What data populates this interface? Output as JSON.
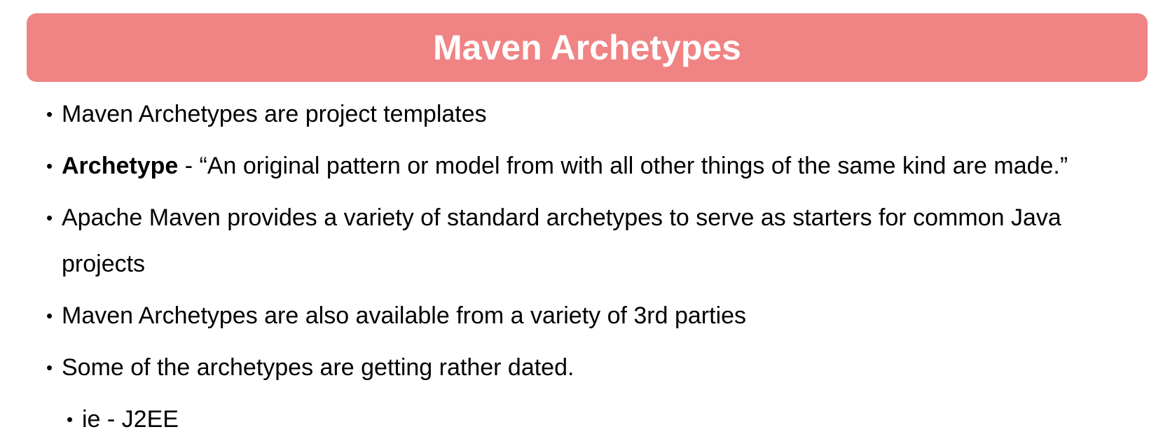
{
  "title": {
    "text": "Maven Archetypes",
    "background_color": "#f08383",
    "text_color": "#ffffff"
  },
  "bullets": [
    {
      "text": "Maven Archetypes are project templates"
    },
    {
      "term": "Archetype",
      "text": " - “An original pattern or model from with all other things of the same kind are made.”"
    },
    {
      "text": "Apache Maven provides a variety of standard archetypes to serve as starters for common Java projects"
    },
    {
      "text": "Maven Archetypes are also available from a variety of 3rd parties"
    },
    {
      "text": "Some of the archetypes are getting rather dated."
    }
  ],
  "sub_bullets": [
    {
      "text": "ie - J2EE"
    }
  ],
  "bullet_symbol": "•"
}
